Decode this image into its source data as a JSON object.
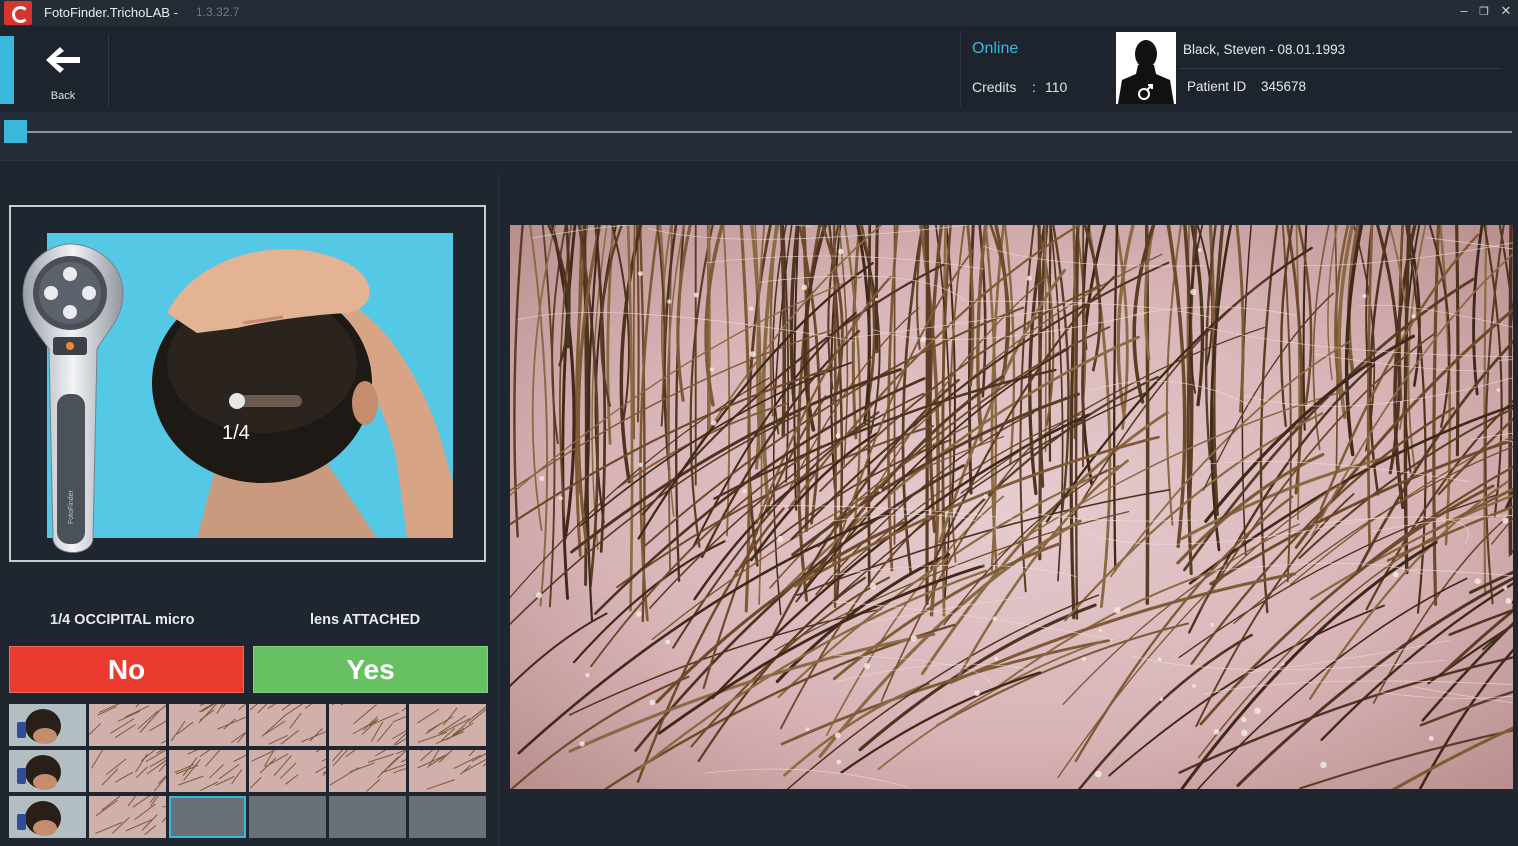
{
  "window": {
    "title": "FotoFinder.TrichoLAB -",
    "version": "1.3.32.7",
    "controls": [
      "–",
      "❐",
      "✕"
    ]
  },
  "header": {
    "back_label": "Back",
    "status": "Online",
    "credits_label": "Credits",
    "credits_sep": ":",
    "credits_value": "110",
    "patient_name": "Black, Steven - 08.01.1993",
    "patient_id_label": "Patient ID",
    "patient_id_value": "345678",
    "gender_symbol": "♂"
  },
  "progress": {
    "fraction": 0.012
  },
  "guide": {
    "position_marker": "1/4",
    "device_brand": "FotoFinder",
    "step_label": "1/4 OCCIPITAL micro",
    "lens_status": "lens ATTACHED"
  },
  "actions": {
    "no_label": "No",
    "yes_label": "Yes"
  },
  "thumbnails": {
    "rows": 3,
    "cols": 6,
    "filled": [
      [
        "head",
        "micro",
        "micro",
        "micro",
        "micro",
        "micro"
      ],
      [
        "head",
        "micro",
        "micro",
        "micro",
        "micro",
        "micro"
      ],
      [
        "head",
        "micro",
        "selected",
        "empty",
        "empty",
        "empty"
      ]
    ]
  },
  "colors": {
    "accent": "#3ab8dc",
    "no": "#e83a2e",
    "yes": "#67c163",
    "background": "#1f2630"
  }
}
